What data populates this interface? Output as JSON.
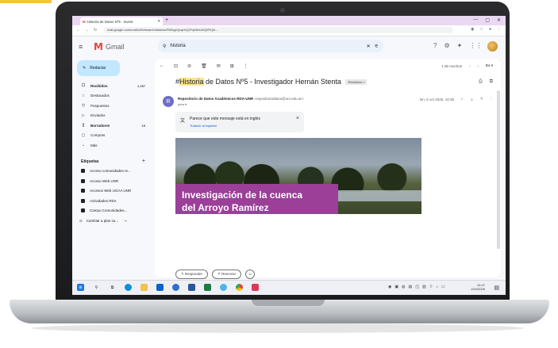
{
  "browser": {
    "tab_title": "Historia de Datos Nº5 - Invest",
    "tab_close": "✕",
    "new_tab": "+",
    "url": "mail.google.com/mail/u/0/#search/historia/FMfcgzQcqrKQZFqDkfxdVQtPKjXr...",
    "window_controls": [
      "—",
      "▢",
      "✕"
    ]
  },
  "gmail": {
    "logo_text": "Gmail",
    "search_query": "historia",
    "compose_label": "Redactar"
  },
  "sidebar": {
    "items": [
      {
        "label": "Recibidos",
        "icon": "inbox-icon",
        "glyph": "☐",
        "count": "1.157",
        "bold": true
      },
      {
        "label": "Destacados",
        "icon": "star-icon",
        "glyph": "☆",
        "count": "",
        "bold": false
      },
      {
        "label": "Pospuestos",
        "icon": "clock-icon",
        "glyph": "◷",
        "count": "",
        "bold": false
      },
      {
        "label": "Enviados",
        "icon": "send-icon",
        "glyph": "▷",
        "count": "",
        "bold": false
      },
      {
        "label": "Borradores",
        "icon": "draft-icon",
        "glyph": "▯",
        "count": "15",
        "bold": true
      },
      {
        "label": "Compras",
        "icon": "shopping-icon",
        "glyph": "▢",
        "count": "",
        "bold": false
      },
      {
        "label": "Más",
        "icon": "chevron-down-icon",
        "glyph": "⌄",
        "count": "",
        "bold": false
      }
    ],
    "labels_title": "Etiquetas",
    "labels_add": "+",
    "labels": [
      "Acceso comunidades re...",
      "Acceso Web UNR",
      "Accesos Web UGAA UNR",
      "Actividades RDA",
      "Campo Comunidades..."
    ],
    "upgrade_text": "Cambiar a plan su..."
  },
  "message": {
    "subject_prefix": "#",
    "subject_highlight": "Historia",
    "subject_rest": " de Datos Nº5 - Investigador Hernán Stenta",
    "label_tag": "Recibidos ×",
    "sender_initial": "R",
    "sender_name": "Repositorio de Datos Académicos RDA-UNR",
    "sender_email": "<repositoriodatos@unr.edu.ar>",
    "to_line": "para ▾",
    "date": "lun, 6 oct 2025, 10:36",
    "translate_msg": "Parece que este mensaje está en inglés",
    "translate_link": "Traducir al español",
    "banner_line1": "Investigación de la cuenca",
    "banner_line2": "del Arroyo Ramírez",
    "reply_label": "Responder",
    "forward_label": "Reenviar",
    "pager_text": "1 de muchos",
    "lang_btn": "Es ▾"
  },
  "taskbar": {
    "clock_time": "14:47",
    "clock_date": "19/4/2026"
  },
  "colors": {
    "tab_bg": "#ead7f2",
    "compose_bg": "#c2e7ff",
    "banner_bg": "#9b3f98",
    "highlight": "#fce68a",
    "gmail_red": "#ea4335"
  }
}
